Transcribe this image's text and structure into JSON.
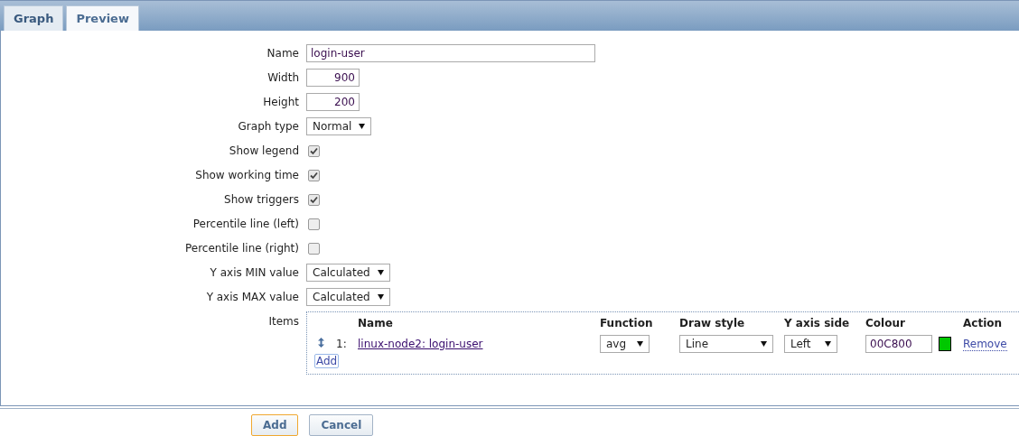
{
  "tabs": [
    {
      "label": "Graph",
      "selected": true
    },
    {
      "label": "Preview",
      "selected": false
    }
  ],
  "fields": [
    {
      "kind": "text",
      "label": "Name",
      "value": "login-user"
    },
    {
      "kind": "number",
      "label": "Width",
      "value": "900"
    },
    {
      "kind": "number",
      "label": "Height",
      "value": "200"
    },
    {
      "kind": "select",
      "label": "Graph type",
      "value": "Normal"
    },
    {
      "kind": "checkbox",
      "label": "Show legend",
      "checked": true
    },
    {
      "kind": "checkbox",
      "label": "Show working time",
      "checked": true
    },
    {
      "kind": "checkbox",
      "label": "Show triggers",
      "checked": true
    },
    {
      "kind": "checkbox",
      "label": "Percentile line (left)",
      "checked": false
    },
    {
      "kind": "checkbox",
      "label": "Percentile line (right)",
      "checked": false
    },
    {
      "kind": "select",
      "label": "Y axis MIN value",
      "value": "Calculated"
    },
    {
      "kind": "select",
      "label": "Y axis MAX value",
      "value": "Calculated"
    }
  ],
  "items": {
    "label": "Items",
    "columns": [
      "Name",
      "Function",
      "Draw style",
      "Y axis side",
      "Colour",
      "Action"
    ],
    "rows": [
      {
        "number": "1:",
        "name": "linux-node2: login-user",
        "function": "avg",
        "draw_style": "Line",
        "y_axis_side": "Left",
        "colour": "00C800",
        "color": "#00c800",
        "action": "Remove"
      }
    ],
    "add_label": "Add"
  },
  "buttons": [
    {
      "label": "Add",
      "kind": "primary"
    },
    {
      "label": "Cancel",
      "kind": "secondary"
    }
  ]
}
